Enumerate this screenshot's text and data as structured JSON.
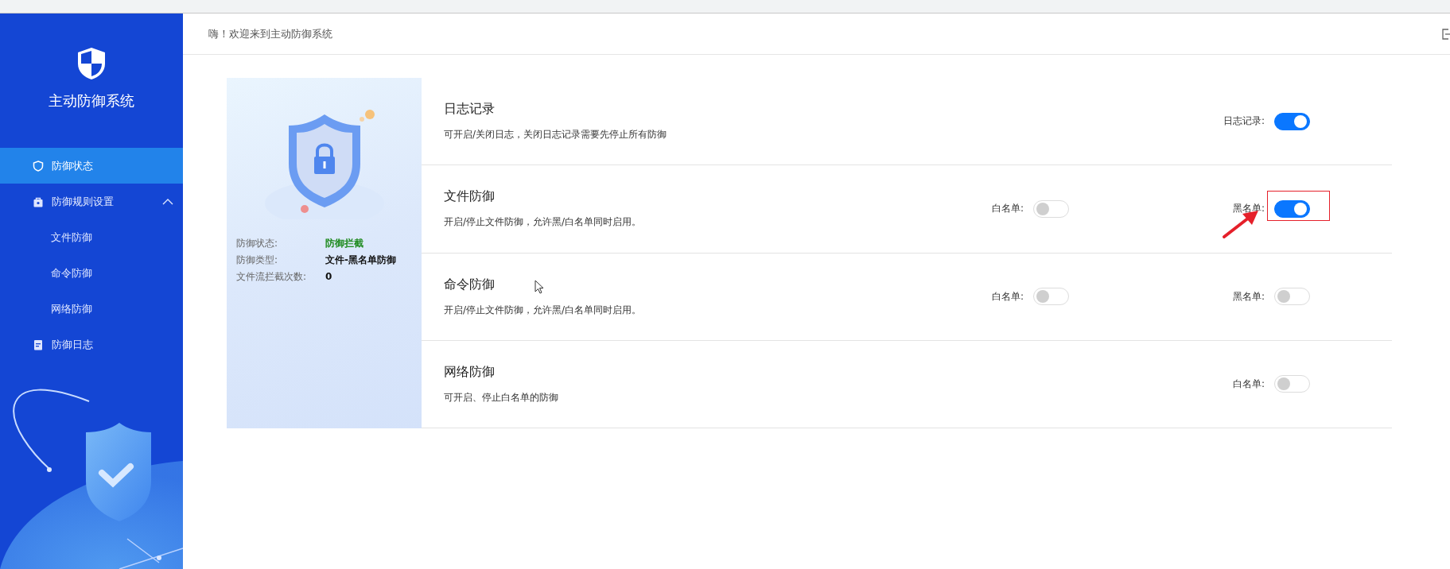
{
  "header": {
    "greeting": "嗨！欢迎来到主动防御系统"
  },
  "sidebar": {
    "title": "主动防御系统",
    "items": [
      {
        "label": "防御状态",
        "selected": true
      },
      {
        "label": "防御规则设置",
        "selected": false,
        "expanded": true,
        "children": [
          {
            "label": "文件防御",
            "selected": false
          },
          {
            "label": "命令防御",
            "selected": false
          },
          {
            "label": "网络防御",
            "selected": false
          }
        ]
      },
      {
        "label": "防御日志",
        "selected": false
      }
    ]
  },
  "status_panel": {
    "fields": [
      {
        "label": "防御状态:",
        "value": "防御拦截",
        "kind": "status"
      },
      {
        "label": "防御类型:",
        "value": "文件-黑名单防御",
        "kind": "plain"
      },
      {
        "label": "文件流拦截次数:",
        "value": "0",
        "kind": "plain"
      }
    ]
  },
  "sections": [
    {
      "title": "日志记录",
      "description": "可开启/关闭日志，关闭日志记录需要先停止所有防御",
      "switches": [
        {
          "label": "日志记录:",
          "on": true,
          "highlighted": false
        }
      ]
    },
    {
      "title": "文件防御",
      "description": "开启/停止文件防御，允许黑/白名单同时启用。",
      "switches": [
        {
          "label": "白名单:",
          "on": false,
          "highlighted": false
        },
        {
          "label": "黑名单:",
          "on": true,
          "highlighted": true
        }
      ]
    },
    {
      "title": "命令防御",
      "description": "开启/停止文件防御，允许黑/白名单同时启用。",
      "switches": [
        {
          "label": "白名单:",
          "on": false,
          "highlighted": false
        },
        {
          "label": "黑名单:",
          "on": false,
          "highlighted": false
        }
      ]
    },
    {
      "title": "网络防御",
      "description": "可开启、停止白名单的防御",
      "switches": [
        {
          "label": "白名单:",
          "on": false,
          "highlighted": false
        }
      ]
    }
  ]
}
